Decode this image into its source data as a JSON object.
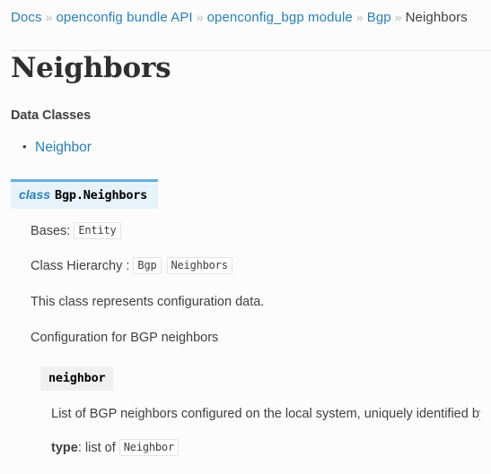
{
  "breadcrumb": {
    "separator": "»",
    "items": [
      {
        "label": "Docs",
        "link": true
      },
      {
        "label": "openconfig bundle API",
        "link": true
      },
      {
        "label": "openconfig_bgp module",
        "link": true
      },
      {
        "label": "Bgp",
        "link": true
      },
      {
        "label": "Neighbors",
        "link": false
      }
    ]
  },
  "page": {
    "title": "Neighbors",
    "data_classes_label": "Data Classes",
    "data_classes": [
      {
        "label": "Neighbor"
      }
    ]
  },
  "class_block": {
    "keyword": "class",
    "name": "Bgp.Neighbors",
    "bases_label": "Bases:",
    "bases": [
      "Entity"
    ],
    "hierarchy_label": "Class Hierarchy :",
    "hierarchy": [
      "Bgp",
      "Neighbors"
    ],
    "description_1": "This class represents configuration data.",
    "description_2": "Configuration for BGP neighbors"
  },
  "attribute": {
    "name": "neighbor",
    "description": "List of BGP neighbors configured on the local system, uniquely identified by neighbor address.",
    "type_label": "type",
    "type_prefix": ": list of",
    "type_value": "Neighbor"
  },
  "colors": {
    "link": "#2980b9",
    "class_block_bg": "#e7f2fa",
    "class_block_border": "#6ab0de",
    "attr_block_bg": "#f0f0f0",
    "text": "#404040",
    "page_bg": "#fcfcfc",
    "rule": "#e1e4e5"
  }
}
